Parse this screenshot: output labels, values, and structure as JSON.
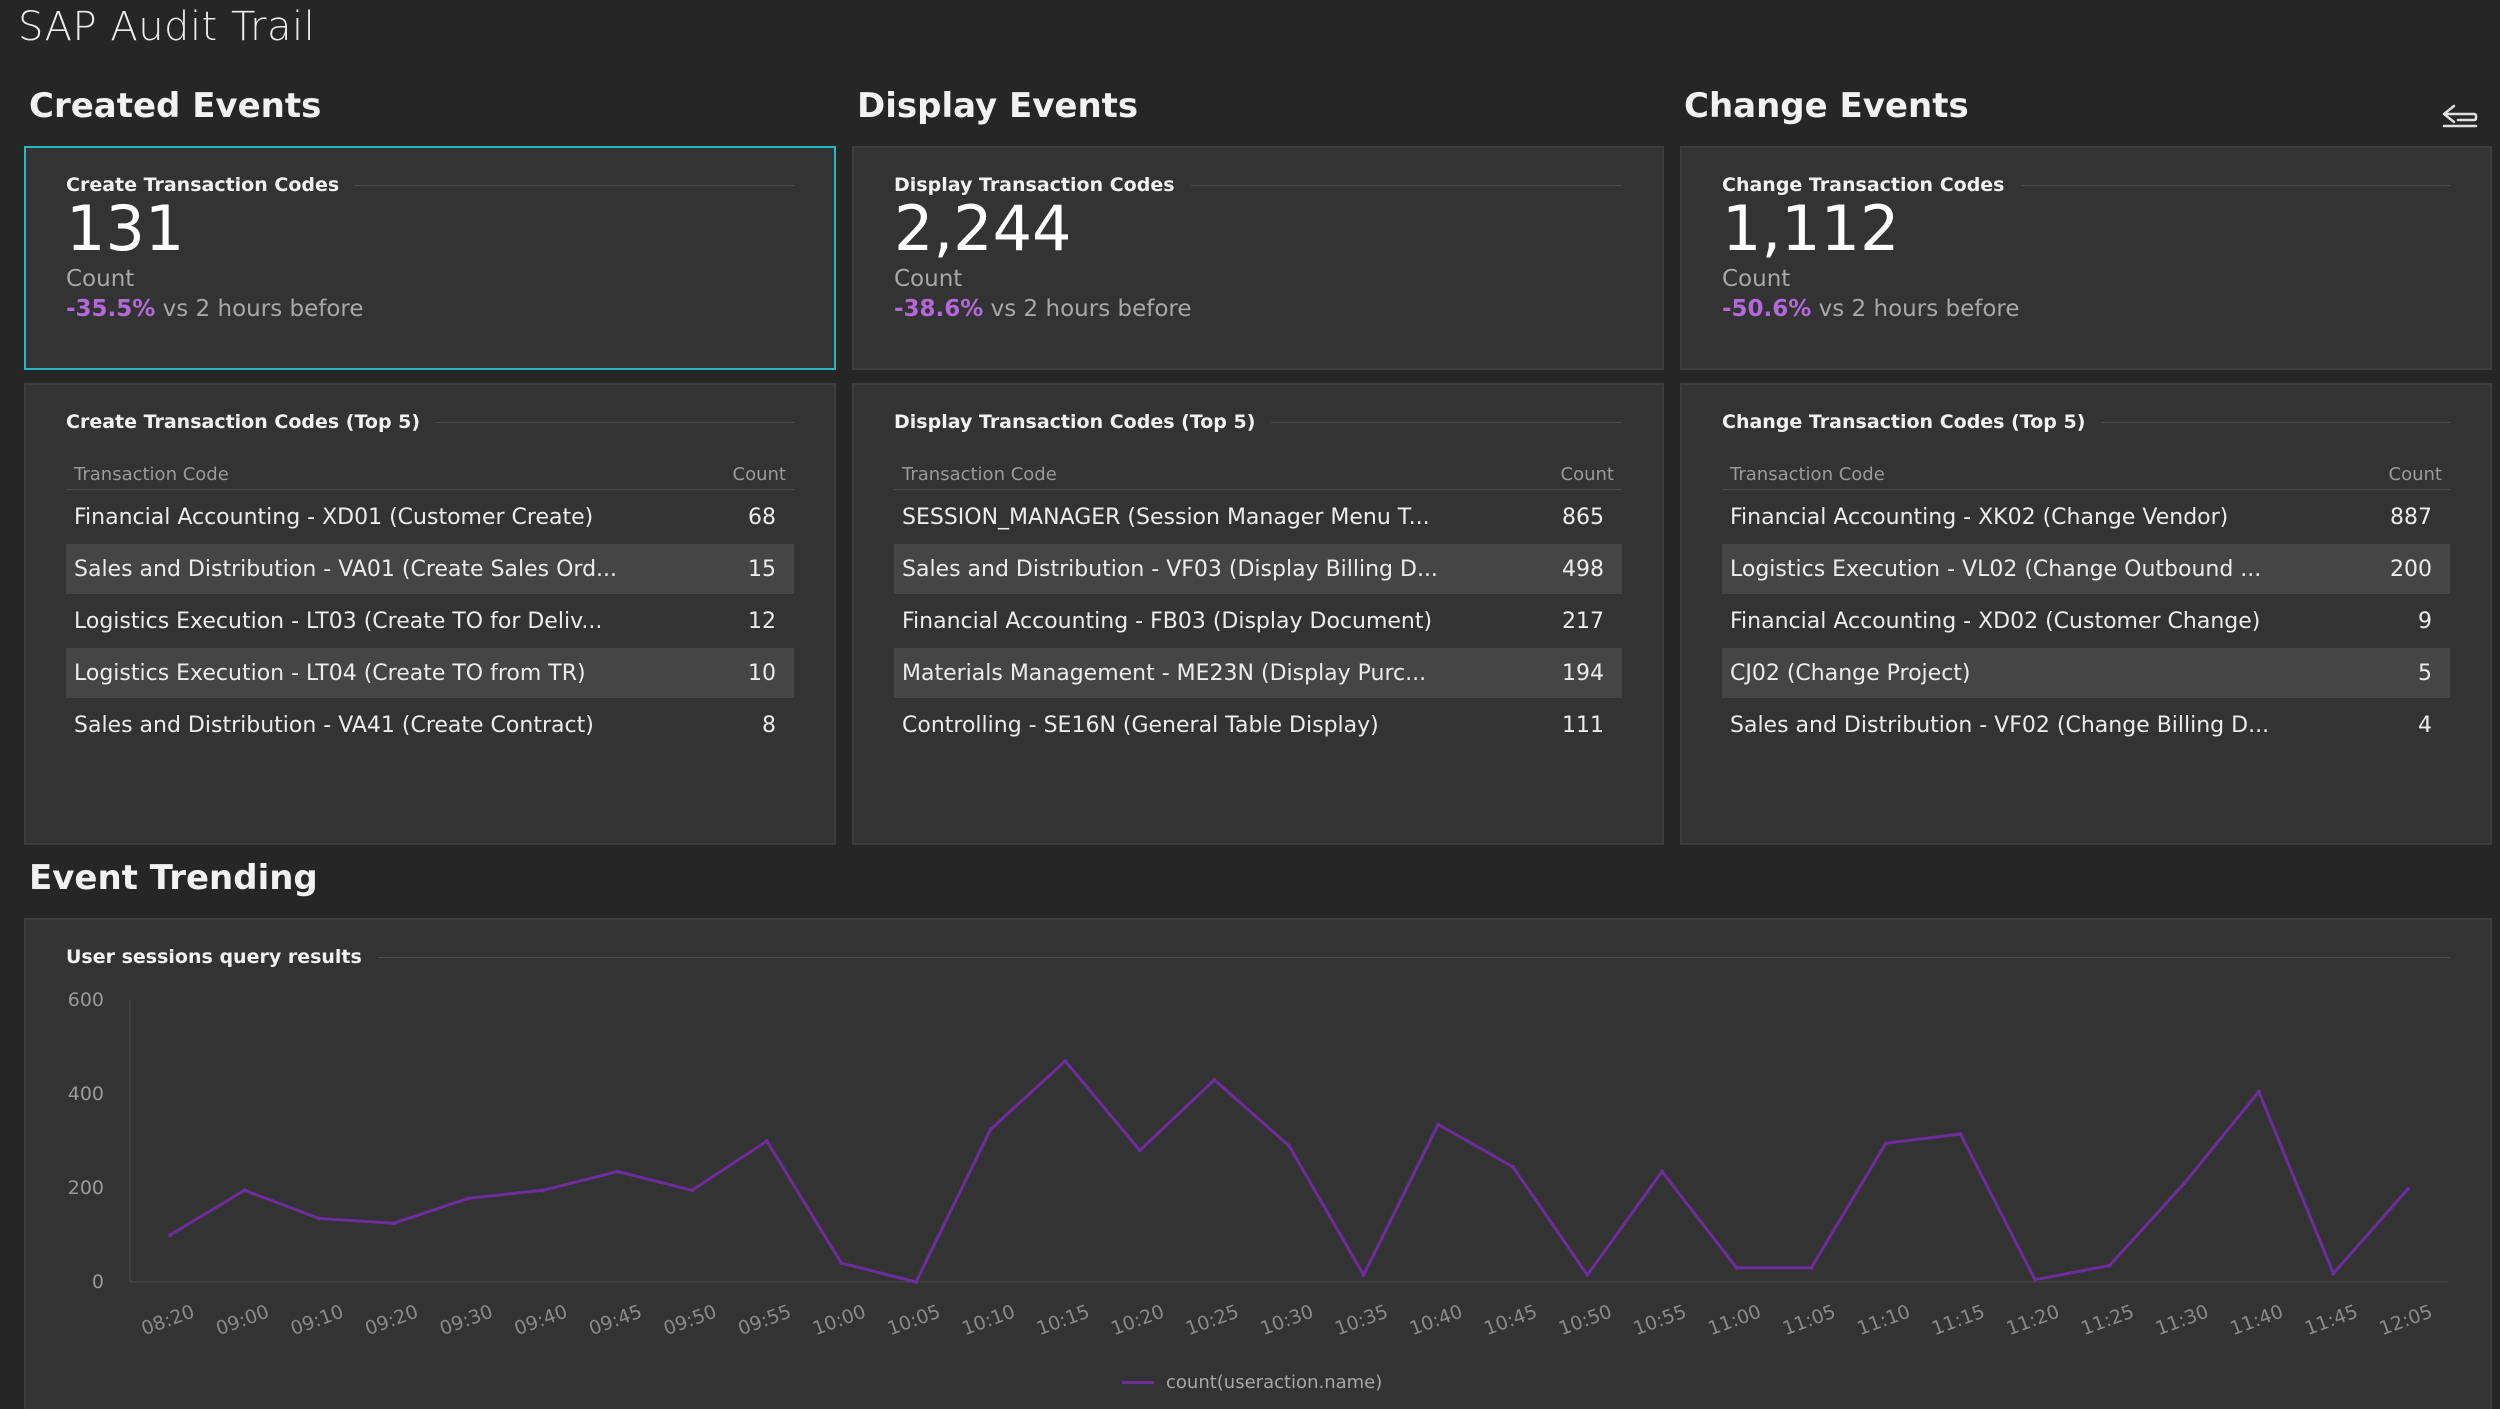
{
  "page": {
    "title": "SAP Audit Trail"
  },
  "sections": {
    "created": "Created Events",
    "display": "Display Events",
    "change": "Change Events",
    "trending": "Event Trending"
  },
  "colors": {
    "accent_selected": "#2ab6c6",
    "delta": "#b36ad8",
    "series": "#6e2c9c",
    "background": "#262626",
    "card": "#333333"
  },
  "icons": {
    "back": "collapse-arrow-icon"
  },
  "kpis": [
    {
      "title": "Create Transaction Codes",
      "value": "131",
      "unit": "Count",
      "delta_pct": "-35.5%",
      "delta_text": "vs 2 hours before"
    },
    {
      "title": "Display Transaction Codes",
      "value": "2,244",
      "unit": "Count",
      "delta_pct": "-38.6%",
      "delta_text": "vs 2 hours before"
    },
    {
      "title": "Change Transaction Codes",
      "value": "1,112",
      "unit": "Count",
      "delta_pct": "-50.6%",
      "delta_text": "vs 2 hours before"
    }
  ],
  "tables": [
    {
      "title": "Create Transaction Codes (Top 5)",
      "col_code": "Transaction Code",
      "col_count": "Count",
      "rows": [
        {
          "name": "Financial Accounting - XD01 (Customer Create)",
          "count": "68"
        },
        {
          "name": "Sales and Distribution - VA01 (Create Sales Ord...",
          "count": "15"
        },
        {
          "name": "Logistics Execution - LT03 (Create TO for Deliv...",
          "count": "12"
        },
        {
          "name": "Logistics Execution - LT04 (Create TO from TR)",
          "count": "10"
        },
        {
          "name": "Sales and Distribution - VA41 (Create Contract)",
          "count": "8"
        }
      ]
    },
    {
      "title": "Display Transaction Codes (Top 5)",
      "col_code": "Transaction Code",
      "col_count": "Count",
      "rows": [
        {
          "name": "SESSION_MANAGER (Session Manager Menu T...",
          "count": "865"
        },
        {
          "name": "Sales and Distribution - VF03 (Display Billing D...",
          "count": "498"
        },
        {
          "name": "Financial Accounting - FB03 (Display Document)",
          "count": "217"
        },
        {
          "name": "Materials Management - ME23N (Display Purc...",
          "count": "194"
        },
        {
          "name": "Controlling - SE16N (General Table Display)",
          "count": "111"
        }
      ]
    },
    {
      "title": "Change Transaction Codes (Top 5)",
      "col_code": "Transaction Code",
      "col_count": "Count",
      "rows": [
        {
          "name": "Financial Accounting - XK02 (Change Vendor)",
          "count": "887"
        },
        {
          "name": "Logistics Execution - VL02 (Change Outbound ...",
          "count": "200"
        },
        {
          "name": "Financial Accounting - XD02 (Customer Change)",
          "count": "9"
        },
        {
          "name": "CJ02 (Change Project)",
          "count": "5"
        },
        {
          "name": "Sales and Distribution - VF02 (Change Billing D...",
          "count": "4"
        }
      ]
    }
  ],
  "chart_card": {
    "title": "User sessions query results"
  },
  "chart_data": {
    "type": "line",
    "title": "User sessions query results",
    "x": [
      "08:20",
      "09:00",
      "09:10",
      "09:20",
      "09:30",
      "09:40",
      "09:45",
      "09:50",
      "09:55",
      "10:00",
      "10:05",
      "10:10",
      "10:15",
      "10:20",
      "10:25",
      "10:30",
      "10:35",
      "10:40",
      "10:45",
      "10:50",
      "10:55",
      "11:00",
      "11:05",
      "11:10",
      "11:15",
      "11:20",
      "11:25",
      "11:30",
      "11:40",
      "11:45",
      "12:05"
    ],
    "series": [
      {
        "name": "count(useraction.name)",
        "values": [
          100,
          195,
          135,
          125,
          178,
          195,
          235,
          195,
          300,
          40,
          0,
          325,
          470,
          280,
          430,
          290,
          15,
          335,
          245,
          15,
          235,
          30,
          30,
          295,
          315,
          5,
          35,
          210,
          405,
          18,
          198
        ]
      }
    ],
    "ylim": [
      0,
      600
    ],
    "yticks": [
      0,
      200,
      400,
      600
    ],
    "legend": "bottom-center",
    "grid": false
  }
}
